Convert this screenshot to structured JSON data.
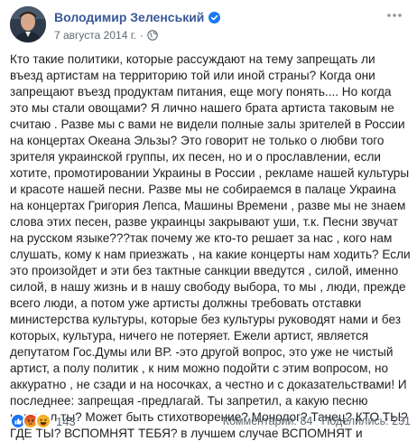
{
  "post": {
    "author": "Володимир Зеленський",
    "date": "7 августа 2014 г.",
    "dot": "·",
    "text": "Кто такие политики, которые рассуждают на тему запрещать ли въезд артистам на территорию той или иной страны? Когда они запрещают въезд продуктам питания, еще могу понять.... Но когда это мы стали овощами? Я лично нашего брата артиста таковым не считаю . Разве мы с вами не видели полные залы зрителей в России на концертах Океана Эльзы? Это говорит не только о любви того зрителя украинской группы, их песен, но и о прославлении, если хотите, промотировании Украины в России , рекламе нашей культуры и красоте нашей песни. Разве мы не собираемся в палаце Украина на концертах Григория Лепса, Машины Времени , разве мы не знаем слова этих песен, разве украинцы закрывают уши, т.к. Песни звучат на русском языке???так почему же кто-то решает за нас , кого нам слушать, кому к нам приезжать , на какие концерты нам ходить? Если это произойдет и эти без тактные санкции введутся , силой, именно силой, в нашу жизнь и в нашу свободу выбора, то мы , люди, прежде всего люди, а потом уже артисты должны требовать отставки министерства культуры, которые без культуры руководят нами и без которых, культура, ничего не потеряет. Ежели артист, является депутатом Гос.Думы или ВР. -это другой вопрос, это уже не чистый артист, а полу политик , к ним можно подойти с этим вопросом, но аккуратно , не сзади и на носочках, а честно и с доказательствами! И последнее: запрещая -предлагай. Ты запретил, а какую песню написал ты? Может быть стихотворение? Монолог? Танец? КТО ТЫ? ГДЕ ТЫ? ВСПОМНЯТ ТЕБЯ? в лучшем случае ВСПОМНЯТ и ПЛЮНУТ.",
    "more_icon": "more-horizontal-icon",
    "verified_icon": "verified-badge-icon",
    "privacy_icon": "globe-icon"
  },
  "footer": {
    "reaction_count": "143",
    "reactions": [
      "like",
      "angry",
      "haha"
    ],
    "comments": "Комментарии: 84",
    "shares": "Поделились: 231"
  },
  "colors": {
    "author": "#385898",
    "meta": "#616770",
    "like": "#1877f2",
    "angry": "#e9710f",
    "haha": "#f7b125"
  }
}
